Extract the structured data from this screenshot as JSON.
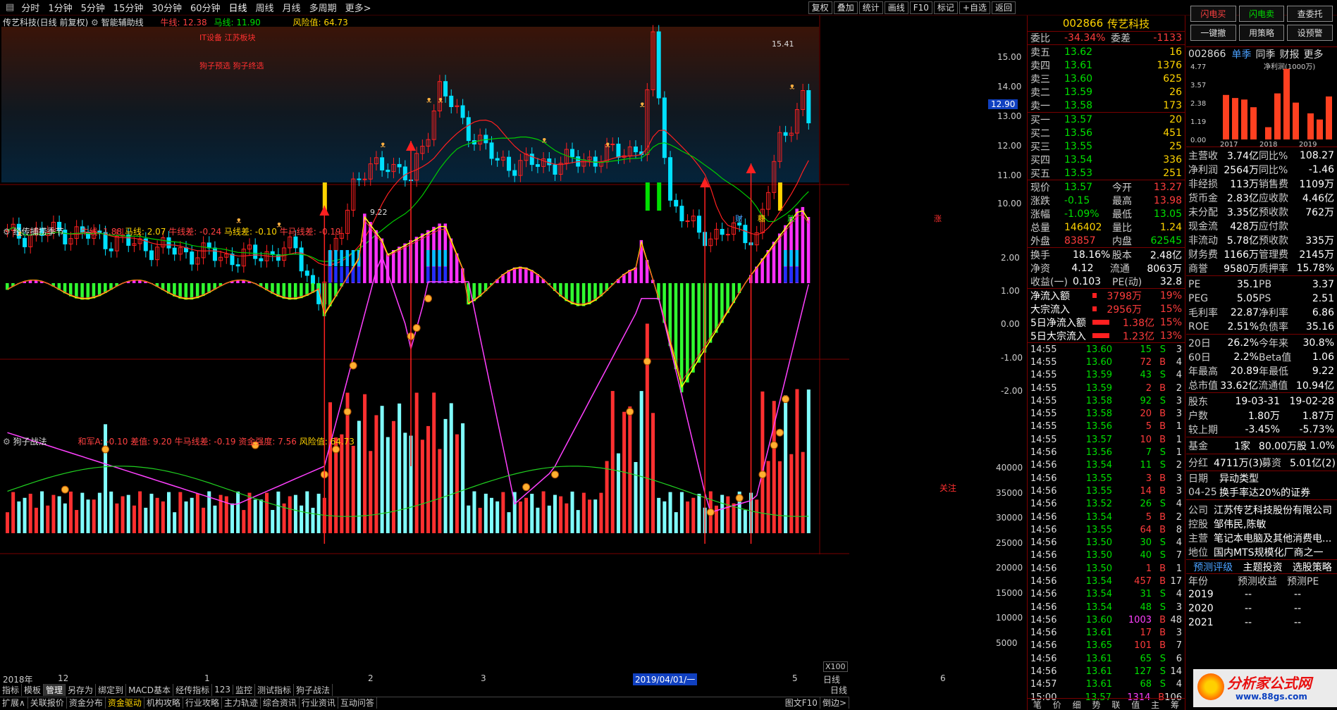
{
  "topbar": {
    "items": [
      "分时",
      "1分钟",
      "5分钟",
      "15分钟",
      "30分钟",
      "60分钟",
      "日线",
      "周线",
      "月线",
      "多周期",
      "更多>"
    ],
    "tools": [
      "复权",
      "叠加",
      "统计",
      "画线",
      "F10",
      "标记",
      "+自选",
      "返回"
    ]
  },
  "main_header": {
    "title": "传艺科技(日线 前复权)",
    "indicator": "智能辅助线",
    "niu": "牛线: 12.38",
    "ma": "马线: 11.90",
    "risk": "风险值: 64.73",
    "note1": "IT设备 江苏板块",
    "note2": "狗子预选 狗子终选",
    "hi": "15.41",
    "lo": "9.22"
  },
  "price_axis": [
    "15.00",
    "14.00",
    "13.00",
    "12.00",
    "11.00",
    "10.00"
  ],
  "current_price": "12.90",
  "chart_markers": [
    "财",
    "糖",
    "跌",
    "涨"
  ],
  "panel2": {
    "title": "经传捕捞季节",
    "niu": "牛线: 1.88",
    "ma": "马线: 2.07",
    "niucha": "牛线差: -0.24",
    "macha": "马线差: -0.10",
    "nmcha": "牛马线差: -0.19",
    "axis": [
      "2.00",
      "1.00",
      "0.00",
      "-1.00",
      "-2.00"
    ]
  },
  "panel3": {
    "title": "狗子战法",
    "hejun": "和军A: -0.10",
    "chazhi": "差值: 9.20",
    "nmcha": "牛马线差: -0.19",
    "zj": "资金强度: 7.56",
    "risk": "风险值: 64.73",
    "axis": [
      "40000",
      "35000",
      "30000",
      "25000",
      "20000",
      "15000",
      "10000",
      "5000"
    ],
    "x100": "X100",
    "note": "关注"
  },
  "date_axis": {
    "labels": [
      "2018年",
      "12",
      "1",
      "2",
      "3",
      "2019/04/01/一",
      "5",
      "6"
    ],
    "right": "日线"
  },
  "bottom_tabs": [
    "指标",
    "模板",
    "管理",
    "另存为",
    "绑定到",
    "MACD基本",
    "经传指标",
    "123",
    "监控",
    "测试指标",
    "狗子战法"
  ],
  "bottom_links": [
    "扩展∧",
    "关联报价",
    "资金分布",
    "资金驱动",
    "机构攻略",
    "行业攻略",
    "主力轨迹",
    "综合资讯",
    "行业资讯",
    "互动问答"
  ],
  "bottom_right": [
    "图文F10",
    "倒边>"
  ],
  "quote": {
    "code": "002866",
    "name": "传艺科技",
    "weibi_l": "委比",
    "weibi": "-34.34%",
    "weicha_l": "委差",
    "weicha": "-1133",
    "asks": [
      [
        "卖五",
        "13.62",
        "16"
      ],
      [
        "卖四",
        "13.61",
        "1376"
      ],
      [
        "卖三",
        "13.60",
        "625"
      ],
      [
        "卖二",
        "13.59",
        "26"
      ],
      [
        "卖一",
        "13.58",
        "173"
      ]
    ],
    "bids": [
      [
        "买一",
        "13.57",
        "20"
      ],
      [
        "买二",
        "13.56",
        "451"
      ],
      [
        "买三",
        "13.55",
        "25"
      ],
      [
        "买四",
        "13.54",
        "336"
      ],
      [
        "买五",
        "13.53",
        "251"
      ]
    ],
    "stats": [
      [
        "现价",
        "13.57",
        "今开",
        "13.27"
      ],
      [
        "涨跌",
        "-0.15",
        "最高",
        "13.98"
      ],
      [
        "涨幅",
        "-1.09%",
        "最低",
        "13.05"
      ],
      [
        "总量",
        "146402",
        "量比",
        "1.24"
      ],
      [
        "外盘",
        "83857",
        "内盘",
        "62545"
      ]
    ],
    "stats2": [
      [
        "换手",
        "18.16%",
        "股本",
        "2.48亿"
      ],
      [
        "净资",
        "4.12",
        "流通",
        "8063万"
      ],
      [
        "收益(一)",
        "0.103",
        "PE(动)",
        "32.8"
      ]
    ],
    "flows": [
      [
        "净流入额",
        "3798万",
        "19%"
      ],
      [
        "大宗流入",
        "2956万",
        "15%"
      ],
      [
        "5日净流入额",
        "1.38亿",
        "15%"
      ],
      [
        "5日大宗流入",
        "1.23亿",
        "13%"
      ]
    ],
    "ticks": [
      [
        "14:55",
        "13.60",
        "15",
        "S",
        "3"
      ],
      [
        "14:55",
        "13.60",
        "72",
        "B",
        "4"
      ],
      [
        "14:55",
        "13.59",
        "43",
        "S",
        "4"
      ],
      [
        "14:55",
        "13.59",
        "2",
        "B",
        "2"
      ],
      [
        "14:55",
        "13.58",
        "92",
        "S",
        "3"
      ],
      [
        "14:55",
        "13.58",
        "20",
        "B",
        "3"
      ],
      [
        "14:55",
        "13.56",
        "5",
        "B",
        "1"
      ],
      [
        "14:55",
        "13.57",
        "10",
        "B",
        "1"
      ],
      [
        "14:56",
        "13.56",
        "7",
        "S",
        "1"
      ],
      [
        "14:56",
        "13.54",
        "11",
        "S",
        "2"
      ],
      [
        "14:56",
        "13.55",
        "3",
        "B",
        "3"
      ],
      [
        "14:56",
        "13.55",
        "14",
        "B",
        "3"
      ],
      [
        "14:56",
        "13.52",
        "26",
        "S",
        "4"
      ],
      [
        "14:56",
        "13.54",
        "5",
        "B",
        "2"
      ],
      [
        "14:56",
        "13.55",
        "64",
        "B",
        "8"
      ],
      [
        "14:56",
        "13.50",
        "30",
        "S",
        "4"
      ],
      [
        "14:56",
        "13.50",
        "40",
        "S",
        "7"
      ],
      [
        "14:56",
        "13.50",
        "1",
        "B",
        "1"
      ],
      [
        "14:56",
        "13.54",
        "457",
        "B",
        "17"
      ],
      [
        "14:56",
        "13.54",
        "31",
        "S",
        "4"
      ],
      [
        "14:56",
        "13.54",
        "48",
        "S",
        "3"
      ],
      [
        "14:56",
        "13.60",
        "1003",
        "B",
        "48"
      ],
      [
        "14:56",
        "13.61",
        "17",
        "B",
        "3"
      ],
      [
        "14:56",
        "13.65",
        "101",
        "B",
        "7"
      ],
      [
        "14:56",
        "13.61",
        "65",
        "S",
        "6"
      ],
      [
        "14:56",
        "13.61",
        "127",
        "S",
        "14"
      ],
      [
        "14:57",
        "13.61",
        "68",
        "S",
        "4"
      ],
      [
        "15:00",
        "13.57",
        "1314",
        "B",
        "106"
      ]
    ],
    "bottom_tabs": [
      "笔",
      "价",
      "细",
      "势",
      "联",
      "值",
      "主",
      "筹"
    ]
  },
  "fpanel": {
    "buttons": [
      "闪电买",
      "闪电卖",
      "查委托",
      "一键撤",
      "用策略",
      "设预警"
    ],
    "code": "002866",
    "tabs": [
      "单季",
      "同季",
      "财报",
      "更多"
    ],
    "chart": {
      "ylabels": [
        "4.77",
        "3.57",
        "2.38",
        "1.19",
        "0.00"
      ],
      "unit": "净利润(1000万)",
      "years": [
        "2017",
        "2018",
        "2019"
      ],
      "values": [
        2.9,
        2.7,
        2.6,
        2.1,
        0.8,
        3.0,
        4.6,
        2.4,
        1.7,
        1.3,
        2.8
      ]
    },
    "fin": [
      [
        "主营收",
        "3.74亿",
        "同比%",
        "108.27"
      ],
      [
        "净利润",
        "2564万",
        "同比%",
        "-1.46"
      ],
      [
        "非经损",
        "113万",
        "销售费",
        "1109万"
      ],
      [
        "货币金",
        "2.83亿",
        "应收款",
        "4.46亿"
      ],
      [
        "未分配",
        "3.35亿",
        "预收款",
        "762万"
      ],
      [
        "现金流",
        "428万",
        "应付款",
        ""
      ],
      [
        "非流动",
        "5.78亿",
        "预收款",
        "335万"
      ],
      [
        "财务费",
        "1166万",
        "管理费",
        "2145万"
      ],
      [
        "商誉",
        "9580万",
        "质押率",
        "15.78%"
      ]
    ],
    "val": [
      [
        "PE",
        "35.1",
        "PB",
        "3.37"
      ],
      [
        "PEG",
        "5.05",
        "PS",
        "2.51"
      ],
      [
        "毛利率",
        "22.87",
        "净利率",
        "6.86"
      ],
      [
        "ROE",
        "2.51%",
        "负债率",
        "35.16"
      ]
    ],
    "perf": [
      [
        "20日",
        "26.2%",
        "今年来",
        "30.8%"
      ],
      [
        "60日",
        "2.2%",
        "Beta值",
        "1.06"
      ],
      [
        "年最高",
        "20.89",
        "年最低",
        "9.22"
      ],
      [
        "总市值",
        "33.62亿",
        "流通值",
        "10.94亿"
      ]
    ],
    "holders": [
      [
        "股东",
        "19-03-31",
        "19-02-28"
      ],
      [
        "户数",
        "1.80万",
        "1.87万"
      ],
      [
        "较上期",
        "-3.45%",
        "-5.73%"
      ]
    ],
    "fund": [
      "基金",
      "1家",
      "80.00万股",
      "1.0%"
    ],
    "div": [
      "分红",
      "4711万(3)",
      "募资",
      "5.01亿(2)"
    ],
    "events": [
      [
        "日期",
        "异动类型"
      ],
      [
        "04-25",
        "换手率达20%的证券"
      ]
    ],
    "company": [
      [
        "公司",
        "江苏传艺科技股份有限公司"
      ],
      [
        "控股",
        "邹伟民,陈敏"
      ],
      [
        "主营",
        "笔记本电脑及其他消费电..."
      ],
      [
        "地位",
        "国内MTS规模化厂商之一"
      ]
    ],
    "forecast_tabs": [
      "预测评级",
      "主题投资",
      "选股策略"
    ],
    "forecast_hdr": [
      "年份",
      "预测收益",
      "预测PE"
    ],
    "forecast": [
      [
        "2019",
        "--",
        "--"
      ],
      [
        "2020",
        "--",
        "--"
      ],
      [
        "2021",
        "--",
        "--"
      ]
    ],
    "watermark": "分析家公式网",
    "watermark_url": "www.88gs.com"
  },
  "chart_data": {
    "type": "line",
    "title": "传艺科技(日线 前复权)",
    "y_range": [
      9.22,
      15.41
    ],
    "last": 12.9
  }
}
